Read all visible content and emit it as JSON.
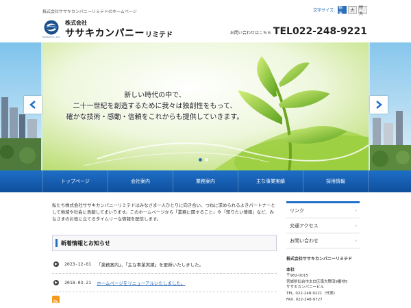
{
  "header": {
    "tagline": "株式会社ササキカンパニーリミテドのホームページ",
    "font_size_label": "文字サイズ:",
    "font_size_options": [
      "標準",
      "大",
      "特大"
    ],
    "logo_sub": "SASAKI Co.,Ltd.",
    "company_small": "株式会社",
    "company_name": "ササキカンパニー",
    "company_suffix": "リミテド",
    "contact_prefix": "お問い合わせはこちら",
    "tel": "TEL022-248-9221"
  },
  "hero": {
    "slide_text": [
      "新しい時代の中で、",
      "二十一世紀を創造するために我々は独創性をもって、",
      "確かな技術・感動・信頼をこれからも提供していきます。"
    ],
    "slide_count": 2,
    "active_slide": 1
  },
  "nav": {
    "items": [
      "トップページ",
      "会社案内",
      "業務案内",
      "主な事業実績",
      "採用情報"
    ]
  },
  "intro": {
    "text": "私たち株式会社ササキカンパニーリミテドはみなさま一人ひとりに向き合い、つねに求められるよきパートナーとして地域や社会に貢献してまいります。このホームページから「業務に関すること」や「知りたい情報」など、みなさまのお役に立てるタイムリーな情報を配信します。"
  },
  "news": {
    "heading": "新着情報とお知らせ",
    "items": [
      {
        "date": "2023-12-01",
        "text": "「業務案内」、「主な事業実績」を更新いたしました。",
        "is_link": false
      },
      {
        "date": "2018-03-21",
        "text": "ホームページをリニューアルいたしました。",
        "is_link": true
      }
    ]
  },
  "sidebar": {
    "menu": [
      "リンク",
      "交通アクセス",
      "お問い合わせ"
    ],
    "info_title": "株式会社ササキカンパニーリミテド",
    "office_label": "本社",
    "postal": "〒982-0015",
    "address": "宮城県仙台市太白区南大野田9番地5",
    "building": "ササキカンパニービル",
    "tel": "TEL. 022-248-9221（代表）",
    "fax": "FAX. 022-248-9727"
  },
  "colors": {
    "accent": "#1e6fc7",
    "nav_dark": "#0f4f9c",
    "rss": "#f39a1e"
  }
}
